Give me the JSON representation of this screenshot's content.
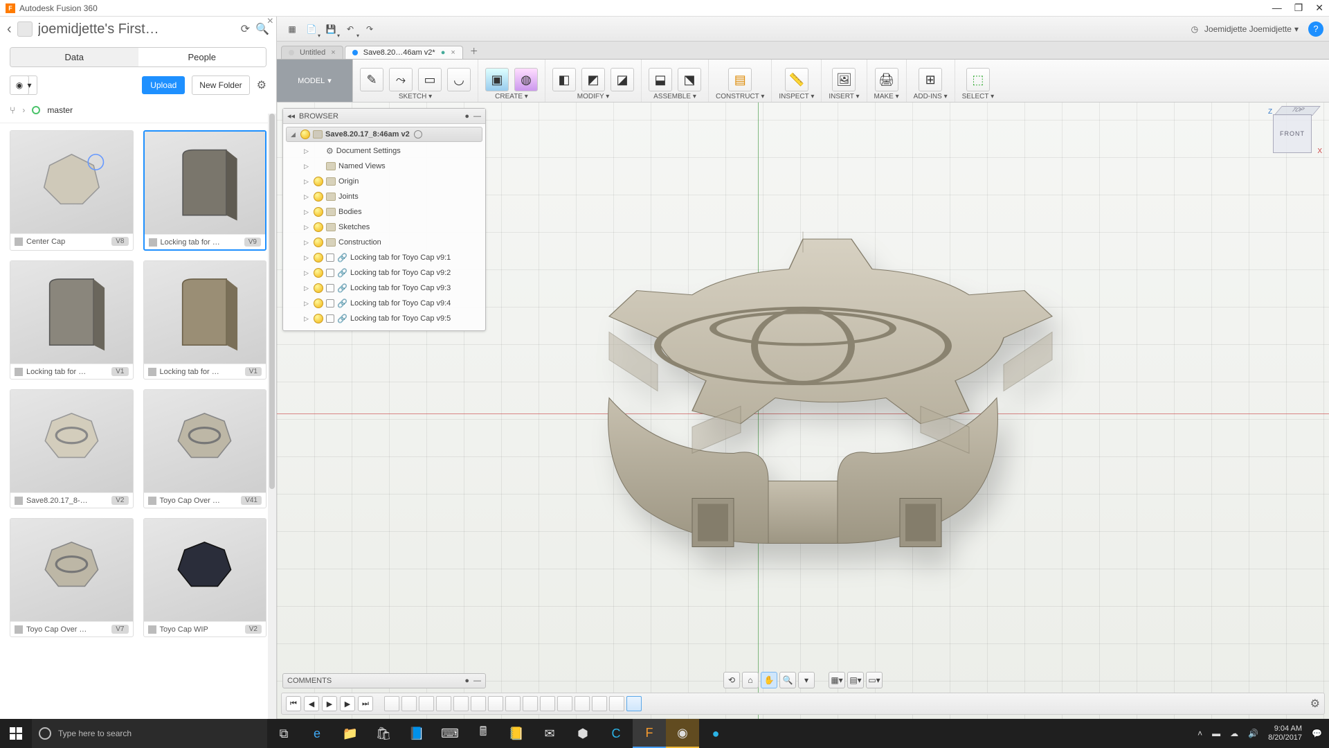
{
  "app": {
    "title": "Autodesk Fusion 360"
  },
  "window_controls": {
    "min": "—",
    "max": "❐",
    "close": "✕"
  },
  "data_panel": {
    "project_title": "joemidjette's First…",
    "tabs": {
      "data": "Data",
      "people": "People"
    },
    "upload": "Upload",
    "new_folder": "New Folder",
    "branch": "master",
    "thumbs": [
      {
        "name": "Center Cap",
        "ver": "V8",
        "sel": false
      },
      {
        "name": "Locking tab for …",
        "ver": "V9",
        "sel": true
      },
      {
        "name": "Locking tab for …",
        "ver": "V1",
        "sel": false
      },
      {
        "name": "Locking tab for …",
        "ver": "V1",
        "sel": false
      },
      {
        "name": "Save8.20.17_8-…",
        "ver": "V2",
        "sel": false
      },
      {
        "name": "Toyo Cap Over …",
        "ver": "V41",
        "sel": false
      },
      {
        "name": "Toyo Cap Over …",
        "ver": "V7",
        "sel": false
      },
      {
        "name": "Toyo Cap WIP",
        "ver": "V2",
        "sel": false
      }
    ]
  },
  "topbar": {
    "user": "Joemidjette Joemidjette"
  },
  "doc_tabs": {
    "untitled": "Untitled",
    "active": "Save8.20…46am v2*"
  },
  "ribbon": {
    "workspace": "MODEL",
    "groups": [
      "SKETCH",
      "CREATE",
      "MODIFY",
      "ASSEMBLE",
      "CONSTRUCT",
      "INSPECT",
      "INSERT",
      "MAKE",
      "ADD-INS",
      "SELECT"
    ]
  },
  "browser": {
    "title": "BROWSER",
    "root": "Save8.20.17_8:46am v2",
    "items": [
      {
        "label": "Document Settings",
        "icon": "gear"
      },
      {
        "label": "Named Views",
        "icon": "folder"
      },
      {
        "label": "Origin",
        "icon": "folder",
        "bulb": true
      },
      {
        "label": "Joints",
        "icon": "folder",
        "bulb": true
      },
      {
        "label": "Bodies",
        "icon": "folder",
        "bulb": true
      },
      {
        "label": "Sketches",
        "icon": "folder",
        "bulb": true
      },
      {
        "label": "Construction",
        "icon": "folder",
        "bulb": true
      },
      {
        "label": "Locking tab for Toyo Cap v9:1",
        "icon": "link",
        "bulb": true,
        "sq": true
      },
      {
        "label": "Locking tab for Toyo Cap v9:2",
        "icon": "link",
        "bulb": true,
        "sq": true
      },
      {
        "label": "Locking tab for Toyo Cap v9:3",
        "icon": "link",
        "bulb": true,
        "sq": true
      },
      {
        "label": "Locking tab for Toyo Cap v9:4",
        "icon": "link",
        "bulb": true,
        "sq": true
      },
      {
        "label": "Locking tab for Toyo Cap v9:5",
        "icon": "link",
        "bulb": true,
        "sq": true
      }
    ]
  },
  "comments": {
    "title": "COMMENTS"
  },
  "viewcube": {
    "front": "FRONT",
    "top": "TOP",
    "x": "X",
    "z": "Z"
  },
  "taskbar": {
    "search_placeholder": "Type here to search",
    "time": "9:04 AM",
    "date": "8/20/2017"
  }
}
